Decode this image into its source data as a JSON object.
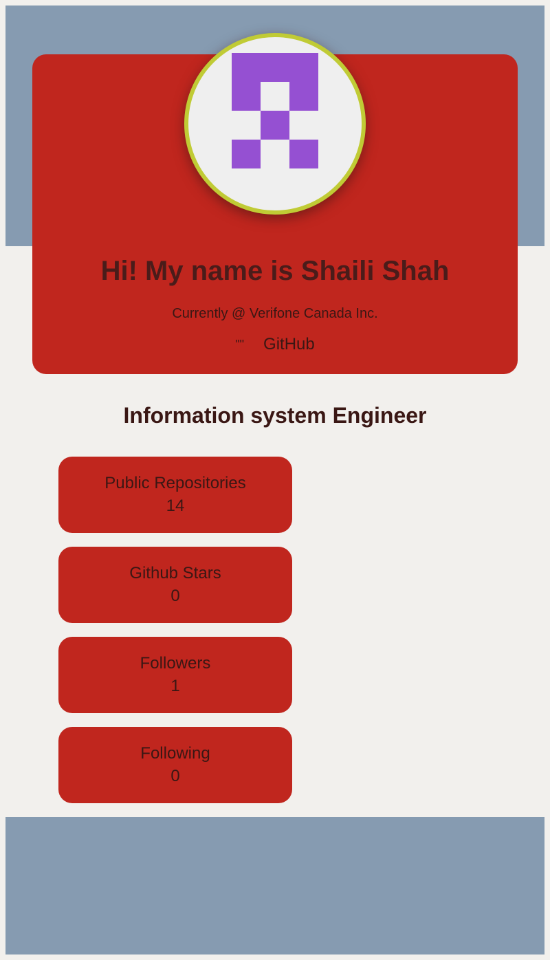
{
  "hero": {
    "title": "Hi! My name is Shaili Shah",
    "subtitle": "Currently @ Verifone Canada Inc.",
    "quote_glyph": "\"\"",
    "github_link": "GitHub"
  },
  "avatar": {
    "icon": "identicon",
    "color": "#9550d2"
  },
  "role": "Information system Engineer",
  "stats": [
    {
      "label": "Public Repositories",
      "value": "14"
    },
    {
      "label": "Github Stars",
      "value": "0"
    },
    {
      "label": "Followers",
      "value": "1"
    },
    {
      "label": "Following",
      "value": "0"
    }
  ],
  "colors": {
    "band": "#869bb1",
    "card": "#c0261e",
    "avatar_ring": "#c0cb35",
    "text": "#3a1714"
  }
}
